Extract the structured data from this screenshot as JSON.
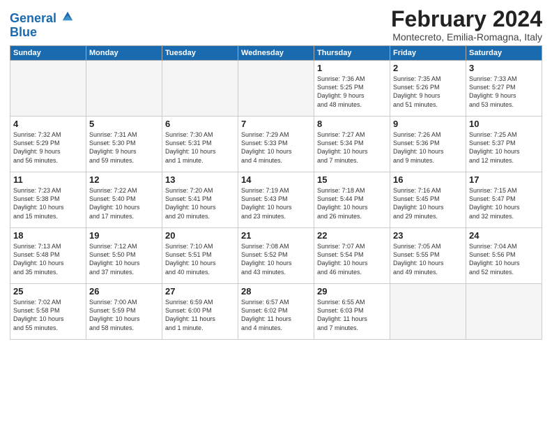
{
  "header": {
    "logo_line1": "General",
    "logo_line2": "Blue",
    "month": "February 2024",
    "location": "Montecreto, Emilia-Romagna, Italy"
  },
  "weekdays": [
    "Sunday",
    "Monday",
    "Tuesday",
    "Wednesday",
    "Thursday",
    "Friday",
    "Saturday"
  ],
  "weeks": [
    [
      {
        "day": "",
        "info": ""
      },
      {
        "day": "",
        "info": ""
      },
      {
        "day": "",
        "info": ""
      },
      {
        "day": "",
        "info": ""
      },
      {
        "day": "1",
        "info": "Sunrise: 7:36 AM\nSunset: 5:25 PM\nDaylight: 9 hours\nand 48 minutes."
      },
      {
        "day": "2",
        "info": "Sunrise: 7:35 AM\nSunset: 5:26 PM\nDaylight: 9 hours\nand 51 minutes."
      },
      {
        "day": "3",
        "info": "Sunrise: 7:33 AM\nSunset: 5:27 PM\nDaylight: 9 hours\nand 53 minutes."
      }
    ],
    [
      {
        "day": "4",
        "info": "Sunrise: 7:32 AM\nSunset: 5:29 PM\nDaylight: 9 hours\nand 56 minutes."
      },
      {
        "day": "5",
        "info": "Sunrise: 7:31 AM\nSunset: 5:30 PM\nDaylight: 9 hours\nand 59 minutes."
      },
      {
        "day": "6",
        "info": "Sunrise: 7:30 AM\nSunset: 5:31 PM\nDaylight: 10 hours\nand 1 minute."
      },
      {
        "day": "7",
        "info": "Sunrise: 7:29 AM\nSunset: 5:33 PM\nDaylight: 10 hours\nand 4 minutes."
      },
      {
        "day": "8",
        "info": "Sunrise: 7:27 AM\nSunset: 5:34 PM\nDaylight: 10 hours\nand 7 minutes."
      },
      {
        "day": "9",
        "info": "Sunrise: 7:26 AM\nSunset: 5:36 PM\nDaylight: 10 hours\nand 9 minutes."
      },
      {
        "day": "10",
        "info": "Sunrise: 7:25 AM\nSunset: 5:37 PM\nDaylight: 10 hours\nand 12 minutes."
      }
    ],
    [
      {
        "day": "11",
        "info": "Sunrise: 7:23 AM\nSunset: 5:38 PM\nDaylight: 10 hours\nand 15 minutes."
      },
      {
        "day": "12",
        "info": "Sunrise: 7:22 AM\nSunset: 5:40 PM\nDaylight: 10 hours\nand 17 minutes."
      },
      {
        "day": "13",
        "info": "Sunrise: 7:20 AM\nSunset: 5:41 PM\nDaylight: 10 hours\nand 20 minutes."
      },
      {
        "day": "14",
        "info": "Sunrise: 7:19 AM\nSunset: 5:43 PM\nDaylight: 10 hours\nand 23 minutes."
      },
      {
        "day": "15",
        "info": "Sunrise: 7:18 AM\nSunset: 5:44 PM\nDaylight: 10 hours\nand 26 minutes."
      },
      {
        "day": "16",
        "info": "Sunrise: 7:16 AM\nSunset: 5:45 PM\nDaylight: 10 hours\nand 29 minutes."
      },
      {
        "day": "17",
        "info": "Sunrise: 7:15 AM\nSunset: 5:47 PM\nDaylight: 10 hours\nand 32 minutes."
      }
    ],
    [
      {
        "day": "18",
        "info": "Sunrise: 7:13 AM\nSunset: 5:48 PM\nDaylight: 10 hours\nand 35 minutes."
      },
      {
        "day": "19",
        "info": "Sunrise: 7:12 AM\nSunset: 5:50 PM\nDaylight: 10 hours\nand 37 minutes."
      },
      {
        "day": "20",
        "info": "Sunrise: 7:10 AM\nSunset: 5:51 PM\nDaylight: 10 hours\nand 40 minutes."
      },
      {
        "day": "21",
        "info": "Sunrise: 7:08 AM\nSunset: 5:52 PM\nDaylight: 10 hours\nand 43 minutes."
      },
      {
        "day": "22",
        "info": "Sunrise: 7:07 AM\nSunset: 5:54 PM\nDaylight: 10 hours\nand 46 minutes."
      },
      {
        "day": "23",
        "info": "Sunrise: 7:05 AM\nSunset: 5:55 PM\nDaylight: 10 hours\nand 49 minutes."
      },
      {
        "day": "24",
        "info": "Sunrise: 7:04 AM\nSunset: 5:56 PM\nDaylight: 10 hours\nand 52 minutes."
      }
    ],
    [
      {
        "day": "25",
        "info": "Sunrise: 7:02 AM\nSunset: 5:58 PM\nDaylight: 10 hours\nand 55 minutes."
      },
      {
        "day": "26",
        "info": "Sunrise: 7:00 AM\nSunset: 5:59 PM\nDaylight: 10 hours\nand 58 minutes."
      },
      {
        "day": "27",
        "info": "Sunrise: 6:59 AM\nSunset: 6:00 PM\nDaylight: 11 hours\nand 1 minute."
      },
      {
        "day": "28",
        "info": "Sunrise: 6:57 AM\nSunset: 6:02 PM\nDaylight: 11 hours\nand 4 minutes."
      },
      {
        "day": "29",
        "info": "Sunrise: 6:55 AM\nSunset: 6:03 PM\nDaylight: 11 hours\nand 7 minutes."
      },
      {
        "day": "",
        "info": ""
      },
      {
        "day": "",
        "info": ""
      }
    ]
  ]
}
